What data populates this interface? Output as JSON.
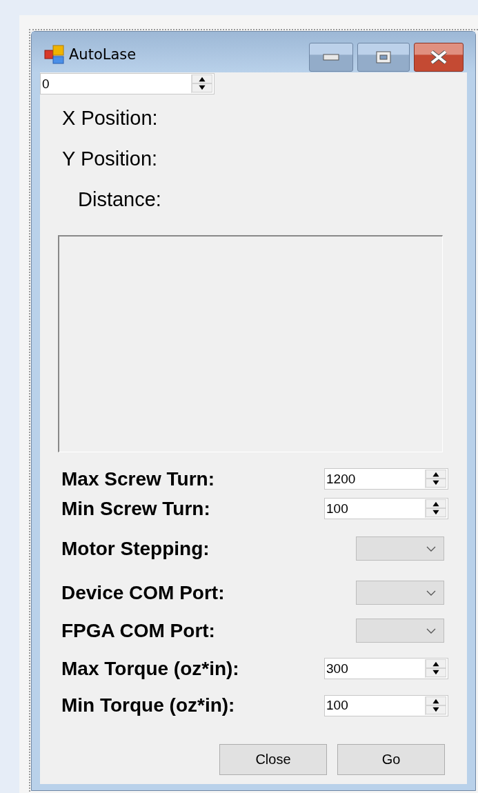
{
  "window": {
    "title": "AutoLase"
  },
  "top_spinner": {
    "value": "0"
  },
  "position_labels": [
    "X Position:",
    "Y Position:",
    "Distance:"
  ],
  "settings": [
    {
      "kind": "spin",
      "label": "Max Screw Turn:",
      "value": "1200"
    },
    {
      "kind": "spin",
      "label": "Min Screw Turn:",
      "value": "100"
    },
    {
      "kind": "combo",
      "label": "Motor Stepping:"
    },
    {
      "kind": "combo",
      "label": "Device COM Port:"
    },
    {
      "kind": "combo",
      "label": "FPGA COM Port:"
    },
    {
      "kind": "spin",
      "label": "Max Torque (oz*in):",
      "value": "300"
    },
    {
      "kind": "spin",
      "label": "Min Torque (oz*in):",
      "value": "100"
    }
  ],
  "buttons": [
    "Close",
    "Go"
  ]
}
